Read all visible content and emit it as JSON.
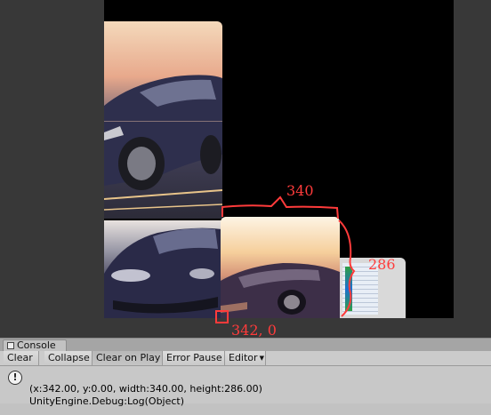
{
  "scene": {
    "annotations": {
      "width_label": "340",
      "height_label": "286",
      "origin_label": "342, 0"
    },
    "colors": {
      "annotation": "#ff3b3b",
      "game_background": "#000000",
      "editor_background": "#383838"
    }
  },
  "console": {
    "tab_label": "Console",
    "toolbar": {
      "clear": "Clear",
      "collapse": "Collapse",
      "clear_on_play": "Clear on Play",
      "error_pause": "Error Pause",
      "editor": "Editor"
    },
    "log": {
      "icon": "info-icon",
      "line1": "(x:342.00, y:0.00, width:340.00, height:286.00)",
      "line2": "UnityEngine.Debug:Log(Object)"
    }
  }
}
